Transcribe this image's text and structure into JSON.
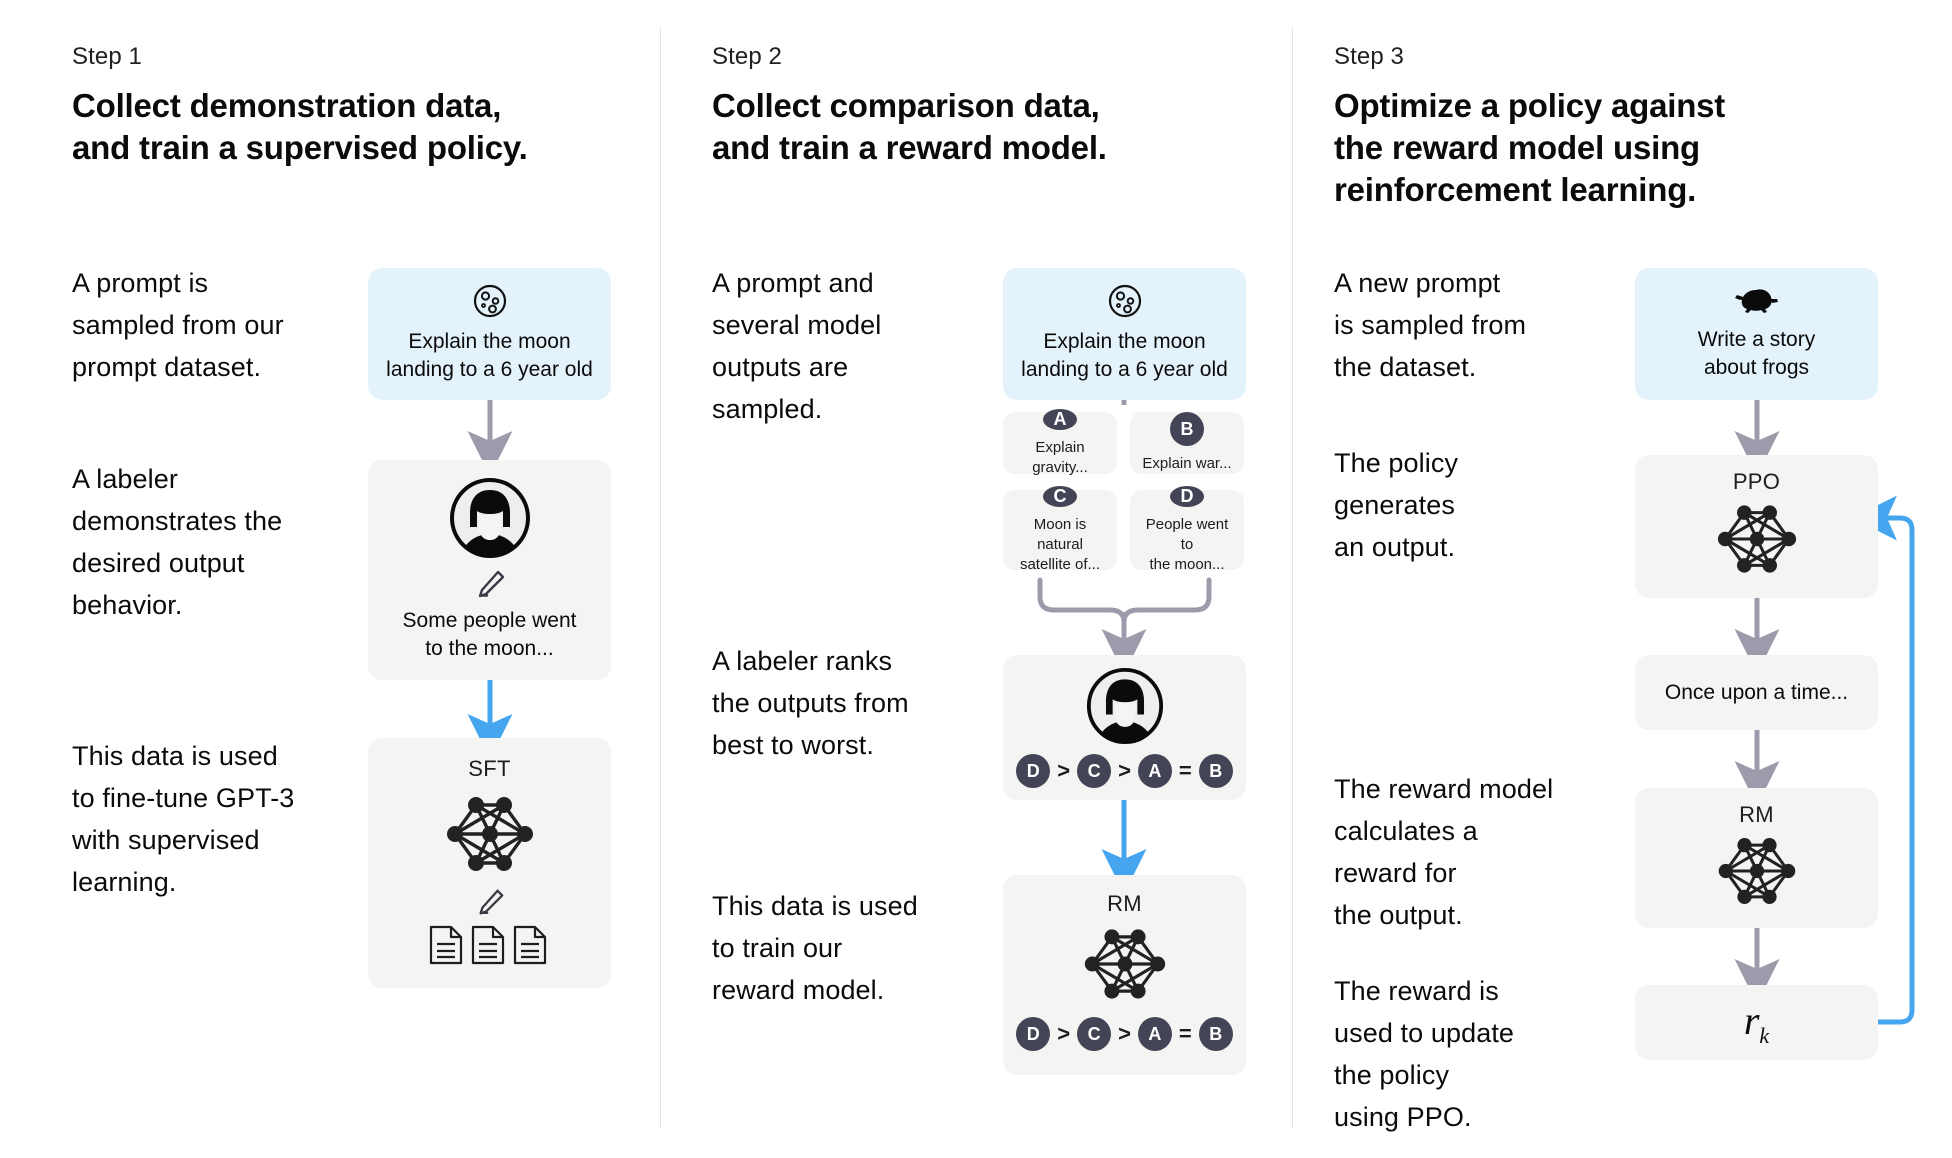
{
  "colors": {
    "prompt_card_bg": "#e4f3fb",
    "model_card_bg": "#f4f4f2",
    "badge_bg": "#434455",
    "arrow_grey": "#9b9bac",
    "arrow_blue": "#45a6ef",
    "divider": "#e3e3e3",
    "text": "#0b0b0b"
  },
  "steps": [
    {
      "label": "Step 1",
      "title": "Collect demonstration data,\nand train a supervised policy.",
      "paragraphs": [
        "A prompt is\nsampled from our\nprompt dataset.",
        "A labeler\ndemonstrates the\ndesired output\nbehavior.",
        "This data is used\nto fine-tune GPT-3\nwith supervised\nlearning."
      ],
      "prompt_card": {
        "icon": "moon-icon",
        "text": "Explain the moon\nlanding to a 6 year old"
      },
      "labeler_card": {
        "icon": "labeler-avatar-icon",
        "tool_icon": "pencil-icon",
        "text": "Some people went\nto the moon..."
      },
      "model_card": {
        "title": "SFT",
        "icon": "neural-network-icon",
        "tool_icon": "pencil-icon",
        "docs_icon": "documents-icon"
      }
    },
    {
      "label": "Step 2",
      "title": "Collect comparison data,\nand train a reward model.",
      "paragraphs": [
        "A prompt and\nseveral model\noutputs are\nsampled.",
        "A labeler ranks\nthe outputs from\nbest to worst.",
        "This data is used\nto train our\nreward model."
      ],
      "prompt_card": {
        "icon": "moon-icon",
        "text": "Explain the moon\nlanding to a 6 year old"
      },
      "outputs": [
        {
          "badge": "A",
          "text": "Explain gravity..."
        },
        {
          "badge": "B",
          "text": "Explain war..."
        },
        {
          "badge": "C",
          "text": "Moon is natural\nsatellite of..."
        },
        {
          "badge": "D",
          "text": "People went to\nthe moon..."
        }
      ],
      "ranking_card": {
        "icon": "labeler-avatar-icon",
        "ranking": [
          "D",
          ">",
          "C",
          ">",
          "A",
          "=",
          "B"
        ]
      },
      "model_card": {
        "title": "RM",
        "icon": "neural-network-icon",
        "ranking": [
          "D",
          ">",
          "C",
          ">",
          "A",
          "=",
          "B"
        ]
      }
    },
    {
      "label": "Step 3",
      "title": "Optimize a policy against\nthe reward model using\nreinforcement learning.",
      "paragraphs": [
        "A new prompt\nis sampled from\nthe dataset.",
        "The policy\ngenerates\nan output.",
        "The reward model\ncalculates a\nreward for\nthe output.",
        "The reward is\nused to update\nthe policy\nusing PPO."
      ],
      "prompt_card": {
        "icon": "frog-icon",
        "text": "Write a story\nabout frogs"
      },
      "policy_card": {
        "title": "PPO",
        "icon": "neural-network-icon"
      },
      "output_card": {
        "text": "Once upon a time..."
      },
      "reward_model_card": {
        "title": "RM",
        "icon": "neural-network-icon"
      },
      "reward_card": {
        "symbol": "r",
        "subscript": "k"
      }
    }
  ]
}
